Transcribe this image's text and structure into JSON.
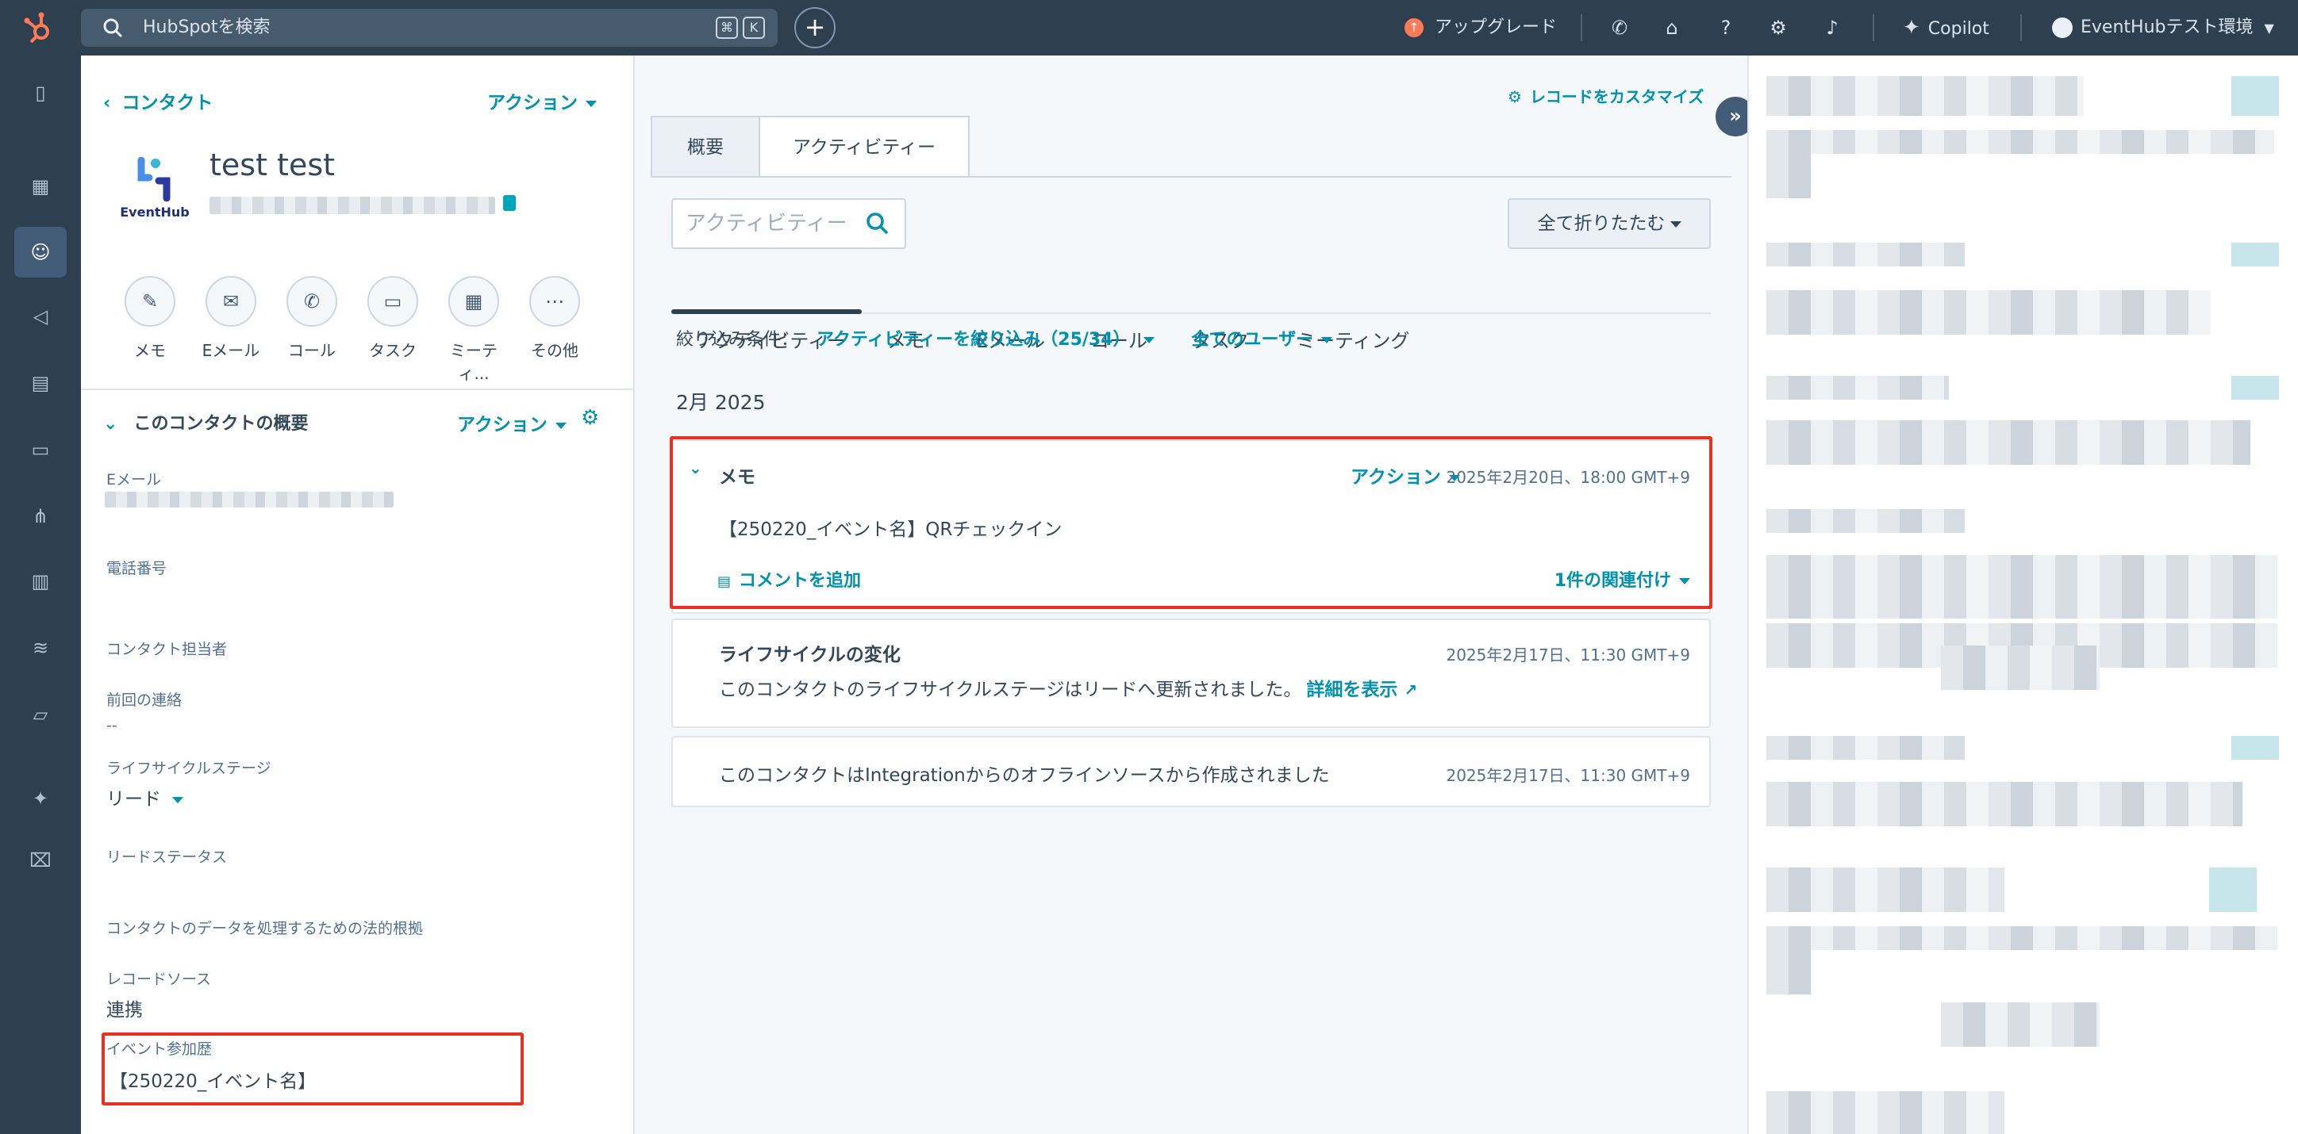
{
  "topbar": {
    "search_placeholder": "HubSpotを検索",
    "shortcut_keys": [
      "⌘",
      "K"
    ],
    "upgrade_label": "アップグレード",
    "copilot_label": "Copilot",
    "account_label": "EventHubテスト環境"
  },
  "left_panel": {
    "breadcrumb": "コンタクト",
    "actions_label": "アクション",
    "company_logo_text": "EventHub",
    "contact_name": "test test",
    "quick_actions": [
      "メモ",
      "Eメール",
      "コール",
      "タスク",
      "ミーティ...",
      "その他"
    ],
    "about_title": "このコンタクトの概要",
    "about_actions_label": "アクション",
    "properties": {
      "email_label": "Eメール",
      "phone_label": "電話番号",
      "owner_label": "コンタクト担当者",
      "last_contacted_label": "前回の連絡",
      "last_contacted_value": "--",
      "lifecycle_label": "ライフサイクルステージ",
      "lifecycle_value": "リード",
      "lead_status_label": "リードステータス",
      "legal_basis_label": "コンタクトのデータを処理するための法的根拠",
      "record_source_label": "レコードソース",
      "record_source_value": "連携",
      "event_history_label": "イベント参加歴",
      "event_history_value": "【250220_イベント名】"
    }
  },
  "middle": {
    "customize_label": "レコードをカスタマイズ",
    "tabs": [
      "概要",
      "アクティビティー"
    ],
    "activity_search_placeholder": "アクティビティー",
    "collapse_all_label": "全て折りたたむ",
    "subtabs": [
      "アクティビティー",
      "メモ",
      "Eメール",
      "コール",
      "タスク",
      "ミーティング"
    ],
    "filter_label": "絞り込み条件：",
    "filter_activity": "アクティビティーを絞り込み（25/34）",
    "filter_users": "全てのユーザー",
    "month_heading": "2月 2025",
    "cards": [
      {
        "title": "メモ",
        "actions_label": "アクション",
        "timestamp": "2025年2月20日、18:00 GMT+9",
        "body": "【250220_イベント名】QRチェックイン",
        "comment_label": "コメントを追加",
        "associations_label": "1件の関連付け"
      },
      {
        "title": "ライフサイクルの変化",
        "timestamp": "2025年2月17日、11:30 GMT+9",
        "body": "このコンタクトのライフサイクルステージはリードへ更新されました。",
        "link_label": "詳細を表示"
      },
      {
        "title": "",
        "timestamp": "2025年2月17日、11:30 GMT+9",
        "body": "このコンタクトはIntegrationからのオフラインソースから作成されました"
      }
    ]
  },
  "colors": {
    "topbar_bg": "#2e3f50",
    "accent_link": "#0091ae",
    "highlight_border": "#e8311f",
    "hubspot_orange": "#ff7a59"
  },
  "icons": {
    "topbar": [
      "phone-icon",
      "marketplace-icon",
      "help-icon",
      "settings-icon",
      "notifications-icon"
    ],
    "leftnav": [
      "bookmark-icon",
      "workspaces-icon",
      "contacts-icon",
      "marketing-icon",
      "content-icon",
      "commerce-icon",
      "automation-icon",
      "reporting-icon",
      "data-management-icon",
      "library-icon",
      "breeze-icon",
      "development-icon"
    ]
  }
}
